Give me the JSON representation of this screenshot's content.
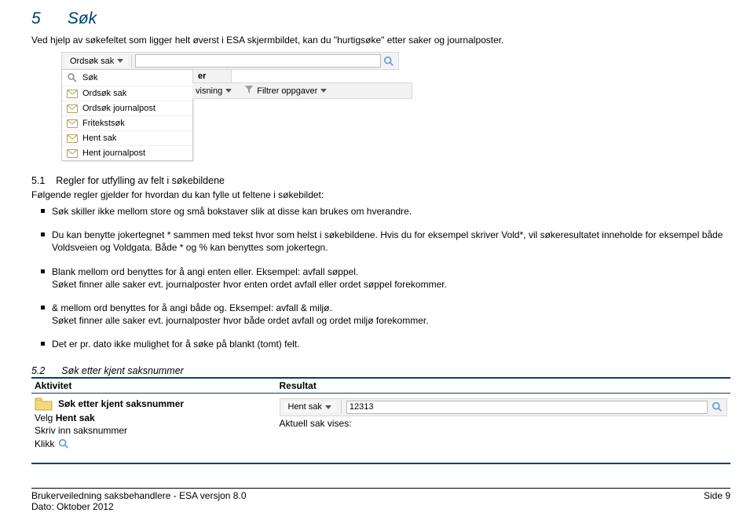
{
  "section5": {
    "num": "5",
    "title": "Søk",
    "intro": "Ved hjelp av søkefeltet som ligger helt øverst i ESA skjermbildet, kan du \"hurtigsøke\" etter saker og journalposter."
  },
  "ui1": {
    "dropdown_label": "Ordsøk sak",
    "menu": {
      "sok": "Søk",
      "ordsok_sak": "Ordsøk sak",
      "ordsok_journalpost": "Ordsøk journalpost",
      "fritekstsok": "Fritekstsøk",
      "hent_sak": "Hent sak",
      "hent_journalpost": "Hent journalpost"
    },
    "partial1": "er",
    "row2_fragment": "visning",
    "row2_filter": "Filtrer oppgaver"
  },
  "section51": {
    "num": "5.1",
    "title": "Regler for utfylling av felt i søkebildene",
    "lead": "Følgende regler gjelder for hvordan du kan fylle ut feltene i søkebildet:",
    "bullets": [
      "Søk skiller ikke mellom store og små bokstaver slik at disse kan brukes om hverandre.",
      "Du kan benytte jokertegnet * sammen med tekst hvor som helst i søkebildene. Hvis du for eksempel skriver Vold*, vil søkeresultatet inneholde for eksempel både Voldsveien og Voldgata. Både * og % kan benyttes som jokertegn.",
      "Blank mellom ord benyttes for å angi enten eller. Eksempel: avfall søppel.\nSøket finner alle saker evt. journalposter hvor enten ordet avfall eller ordet søppel forekommer.",
      "& mellom ord benyttes for å angi både og. Eksempel: avfall & miljø.\nSøket finner alle saker evt. journalposter hvor både ordet avfall og ordet miljø forekommer.",
      "Det er pr. dato ikke mulighet for å søke på blankt (tomt) felt."
    ]
  },
  "section52": {
    "num": "5.2",
    "title": "Søk etter kjent saksnummer",
    "thead": {
      "col1": "Aktivitet",
      "col2": "Resultat"
    },
    "row": {
      "title": "Søk etter kjent saksnummer",
      "line1_pre": "Velg ",
      "line1_bold": "Hent sak",
      "line2": "Skriv inn saksnummer",
      "line3": "Klikk",
      "result": "Aktuell sak vises:"
    }
  },
  "ui2": {
    "dropdown_label": "Hent sak",
    "value": "12313"
  },
  "footer": {
    "left_line1": "Brukerveiledning saksbehandlere - ESA versjon 8.0",
    "left_line2": "Dato: Oktober 2012",
    "right": "Side 9"
  }
}
